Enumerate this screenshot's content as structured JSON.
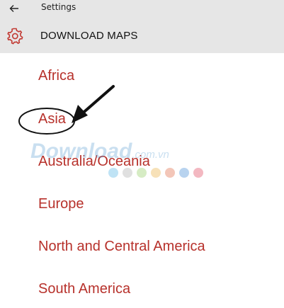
{
  "header": {
    "app_title": "Settings",
    "page_title": "DOWNLOAD MAPS",
    "back_icon": "arrow-left-icon",
    "settings_icon": "gear-icon"
  },
  "regions": [
    {
      "label": "Africa"
    },
    {
      "label": "Asia"
    },
    {
      "label": "Australia/Oceania"
    },
    {
      "label": "Europe"
    },
    {
      "label": "North and Central America"
    },
    {
      "label": "South America"
    }
  ],
  "watermark": {
    "brand": "Download",
    "domain": ".com.vn",
    "dot_colors": [
      "#bfe3f5",
      "#e0e0e0",
      "#d6ecc4",
      "#f7e1b8",
      "#f3c6b8",
      "#b8d3ef",
      "#f3b8c1"
    ]
  },
  "colors": {
    "accent": "#b7312b",
    "header_bg": "#e6e6e6"
  }
}
